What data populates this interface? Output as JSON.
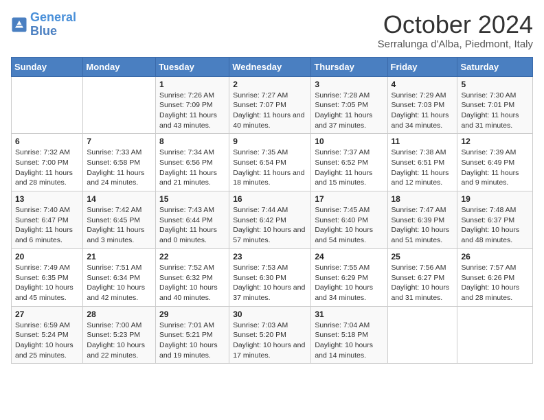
{
  "logo": {
    "line1": "General",
    "line2": "Blue"
  },
  "title": "October 2024",
  "location": "Serralunga d'Alba, Piedmont, Italy",
  "days_of_week": [
    "Sunday",
    "Monday",
    "Tuesday",
    "Wednesday",
    "Thursday",
    "Friday",
    "Saturday"
  ],
  "weeks": [
    [
      {
        "day": "",
        "info": ""
      },
      {
        "day": "",
        "info": ""
      },
      {
        "day": "1",
        "info": "Sunrise: 7:26 AM\nSunset: 7:09 PM\nDaylight: 11 hours and 43 minutes."
      },
      {
        "day": "2",
        "info": "Sunrise: 7:27 AM\nSunset: 7:07 PM\nDaylight: 11 hours and 40 minutes."
      },
      {
        "day": "3",
        "info": "Sunrise: 7:28 AM\nSunset: 7:05 PM\nDaylight: 11 hours and 37 minutes."
      },
      {
        "day": "4",
        "info": "Sunrise: 7:29 AM\nSunset: 7:03 PM\nDaylight: 11 hours and 34 minutes."
      },
      {
        "day": "5",
        "info": "Sunrise: 7:30 AM\nSunset: 7:01 PM\nDaylight: 11 hours and 31 minutes."
      }
    ],
    [
      {
        "day": "6",
        "info": "Sunrise: 7:32 AM\nSunset: 7:00 PM\nDaylight: 11 hours and 28 minutes."
      },
      {
        "day": "7",
        "info": "Sunrise: 7:33 AM\nSunset: 6:58 PM\nDaylight: 11 hours and 24 minutes."
      },
      {
        "day": "8",
        "info": "Sunrise: 7:34 AM\nSunset: 6:56 PM\nDaylight: 11 hours and 21 minutes."
      },
      {
        "day": "9",
        "info": "Sunrise: 7:35 AM\nSunset: 6:54 PM\nDaylight: 11 hours and 18 minutes."
      },
      {
        "day": "10",
        "info": "Sunrise: 7:37 AM\nSunset: 6:52 PM\nDaylight: 11 hours and 15 minutes."
      },
      {
        "day": "11",
        "info": "Sunrise: 7:38 AM\nSunset: 6:51 PM\nDaylight: 11 hours and 12 minutes."
      },
      {
        "day": "12",
        "info": "Sunrise: 7:39 AM\nSunset: 6:49 PM\nDaylight: 11 hours and 9 minutes."
      }
    ],
    [
      {
        "day": "13",
        "info": "Sunrise: 7:40 AM\nSunset: 6:47 PM\nDaylight: 11 hours and 6 minutes."
      },
      {
        "day": "14",
        "info": "Sunrise: 7:42 AM\nSunset: 6:45 PM\nDaylight: 11 hours and 3 minutes."
      },
      {
        "day": "15",
        "info": "Sunrise: 7:43 AM\nSunset: 6:44 PM\nDaylight: 11 hours and 0 minutes."
      },
      {
        "day": "16",
        "info": "Sunrise: 7:44 AM\nSunset: 6:42 PM\nDaylight: 10 hours and 57 minutes."
      },
      {
        "day": "17",
        "info": "Sunrise: 7:45 AM\nSunset: 6:40 PM\nDaylight: 10 hours and 54 minutes."
      },
      {
        "day": "18",
        "info": "Sunrise: 7:47 AM\nSunset: 6:39 PM\nDaylight: 10 hours and 51 minutes."
      },
      {
        "day": "19",
        "info": "Sunrise: 7:48 AM\nSunset: 6:37 PM\nDaylight: 10 hours and 48 minutes."
      }
    ],
    [
      {
        "day": "20",
        "info": "Sunrise: 7:49 AM\nSunset: 6:35 PM\nDaylight: 10 hours and 45 minutes."
      },
      {
        "day": "21",
        "info": "Sunrise: 7:51 AM\nSunset: 6:34 PM\nDaylight: 10 hours and 42 minutes."
      },
      {
        "day": "22",
        "info": "Sunrise: 7:52 AM\nSunset: 6:32 PM\nDaylight: 10 hours and 40 minutes."
      },
      {
        "day": "23",
        "info": "Sunrise: 7:53 AM\nSunset: 6:30 PM\nDaylight: 10 hours and 37 minutes."
      },
      {
        "day": "24",
        "info": "Sunrise: 7:55 AM\nSunset: 6:29 PM\nDaylight: 10 hours and 34 minutes."
      },
      {
        "day": "25",
        "info": "Sunrise: 7:56 AM\nSunset: 6:27 PM\nDaylight: 10 hours and 31 minutes."
      },
      {
        "day": "26",
        "info": "Sunrise: 7:57 AM\nSunset: 6:26 PM\nDaylight: 10 hours and 28 minutes."
      }
    ],
    [
      {
        "day": "27",
        "info": "Sunrise: 6:59 AM\nSunset: 5:24 PM\nDaylight: 10 hours and 25 minutes."
      },
      {
        "day": "28",
        "info": "Sunrise: 7:00 AM\nSunset: 5:23 PM\nDaylight: 10 hours and 22 minutes."
      },
      {
        "day": "29",
        "info": "Sunrise: 7:01 AM\nSunset: 5:21 PM\nDaylight: 10 hours and 19 minutes."
      },
      {
        "day": "30",
        "info": "Sunrise: 7:03 AM\nSunset: 5:20 PM\nDaylight: 10 hours and 17 minutes."
      },
      {
        "day": "31",
        "info": "Sunrise: 7:04 AM\nSunset: 5:18 PM\nDaylight: 10 hours and 14 minutes."
      },
      {
        "day": "",
        "info": ""
      },
      {
        "day": "",
        "info": ""
      }
    ]
  ]
}
